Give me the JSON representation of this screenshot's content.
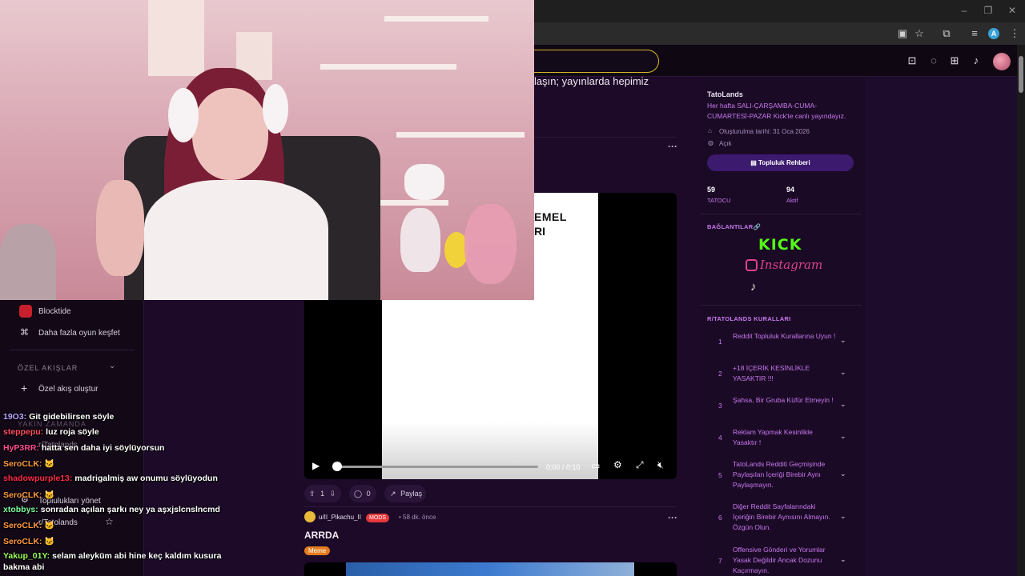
{
  "browser": {
    "minimize": "–",
    "maximize": "❐",
    "close": "✕",
    "toolbar_icons": [
      "cast-icon",
      "star-icon",
      "extensions-icon",
      "reading-list-icon",
      "profile-icon",
      "menu-icon"
    ],
    "profile_letter": "A"
  },
  "header": {
    "icons": [
      "ad-icon",
      "chat-icon",
      "create-icon",
      "bell-icon"
    ]
  },
  "left_nav": {
    "items": [
      {
        "label": "Blocktide",
        "icon": "game-icon"
      },
      {
        "label": "Daha fazla oyun keşfet",
        "icon": "controller-icon"
      }
    ],
    "custom_feeds_label": "ÖZEL AKIŞLAR",
    "create_feed": "Özel akış oluştur",
    "recent_label": "YAKIN ZAMANDA",
    "recent_item": "r/Tatolands",
    "manage_communities": "Toplulukları yönet",
    "community_item": "r/Tatolands"
  },
  "chat": [
    {
      "user": "19O3:",
      "msg": "Git gidebilirsen söyle",
      "color": "#b9a6ff"
    },
    {
      "user": "steppepu:",
      "msg": "luz roja söyle",
      "color": "#ff4d5e"
    },
    {
      "user": "HyP3RR:",
      "msg": "hatta sen daha iyi söylüyorsun",
      "color": "#ff4d8d"
    },
    {
      "user": "SeroCLK:",
      "msg": "",
      "color": "#ff9a3c"
    },
    {
      "user": "shadowpurple13:",
      "msg": "madrigalmiş aw onumu söylüyodun",
      "color": "#ff2a48"
    },
    {
      "user": "SeroCLK:",
      "msg": "",
      "color": "#ff9a3c"
    },
    {
      "user": "xtobbys:",
      "msg": "sonradan açılan şarkı ney ya aşxjslcnslncmd",
      "color": "#7cff9a"
    },
    {
      "user": "SeroCLK:",
      "msg": "",
      "color": "#ff9a3c"
    },
    {
      "user": "SeroCLK:",
      "msg": "",
      "color": "#ff9a3c"
    },
    {
      "user": "Yakup_01Y:",
      "msg": "selam aleyküm abi hine keç kaldım kusura",
      "color": "#9bff5a"
    },
    {
      "user": "",
      "msg": "bakma abi",
      "color": "#ffffff"
    }
  ],
  "post1": {
    "title_snippet": "laşın; yayınlarda hepimiz"
  },
  "video": {
    "text_line1": "EMEL",
    "text_line2": "RI",
    "time": "0:00 / 0:10",
    "progress": 0.0
  },
  "post_actions": {
    "upvotes": "1",
    "comments": "0",
    "share": "Paylaş"
  },
  "post2": {
    "author": "u/II_Pikachu_II",
    "badge": "MODS",
    "time": "58 dk. önce",
    "title": "ARRDA",
    "flair": "Meme"
  },
  "sidebar": {
    "name": "TatoLands",
    "description": "Her hafta SALI-ÇARŞAMBA-CUMA-CUMARTESİ-PAZAR Kick'te canlı yayındayız.",
    "created": "Oluşturulma tarihi: 31 Oca 2026",
    "visibility": "Açık",
    "guide_button": "Topluluk Rehberi",
    "members": "59",
    "members_label": "TATOCU",
    "online": "94",
    "online_label": "Aktif",
    "links_title": "BAĞLANTILAR🔗",
    "link_kick": "KICK",
    "link_instagram": "Instagram",
    "rules_title": "R/TATOLANDS KURALLARI",
    "rules": [
      {
        "num": "1",
        "text": "Reddit Topluluk Kurallarına Uyun !"
      },
      {
        "num": "2",
        "text": "+18 İÇERİK KESİNLİKLE YASAKTIR !!!"
      },
      {
        "num": "3",
        "text": "Şahsa, Bir Gruba Küfür Etmeyin !"
      },
      {
        "num": "4",
        "text": "Reklam Yapmak Kesinlikle Yasaktır !"
      },
      {
        "num": "5",
        "text": "TatoLands Redditi Geçmişinde Paylaşılan İçeriği Birebir Aynı Paylaşmayın."
      },
      {
        "num": "6",
        "text": "Diğer Reddit Sayfalarındaki İçeriğin Birebir Aynısını Almayın. Özgün Olun."
      },
      {
        "num": "7",
        "text": "Offensive Gönderi ve Yorumlar Yasak Değildir Ancak Dozunu Kaçırmayın."
      }
    ]
  }
}
